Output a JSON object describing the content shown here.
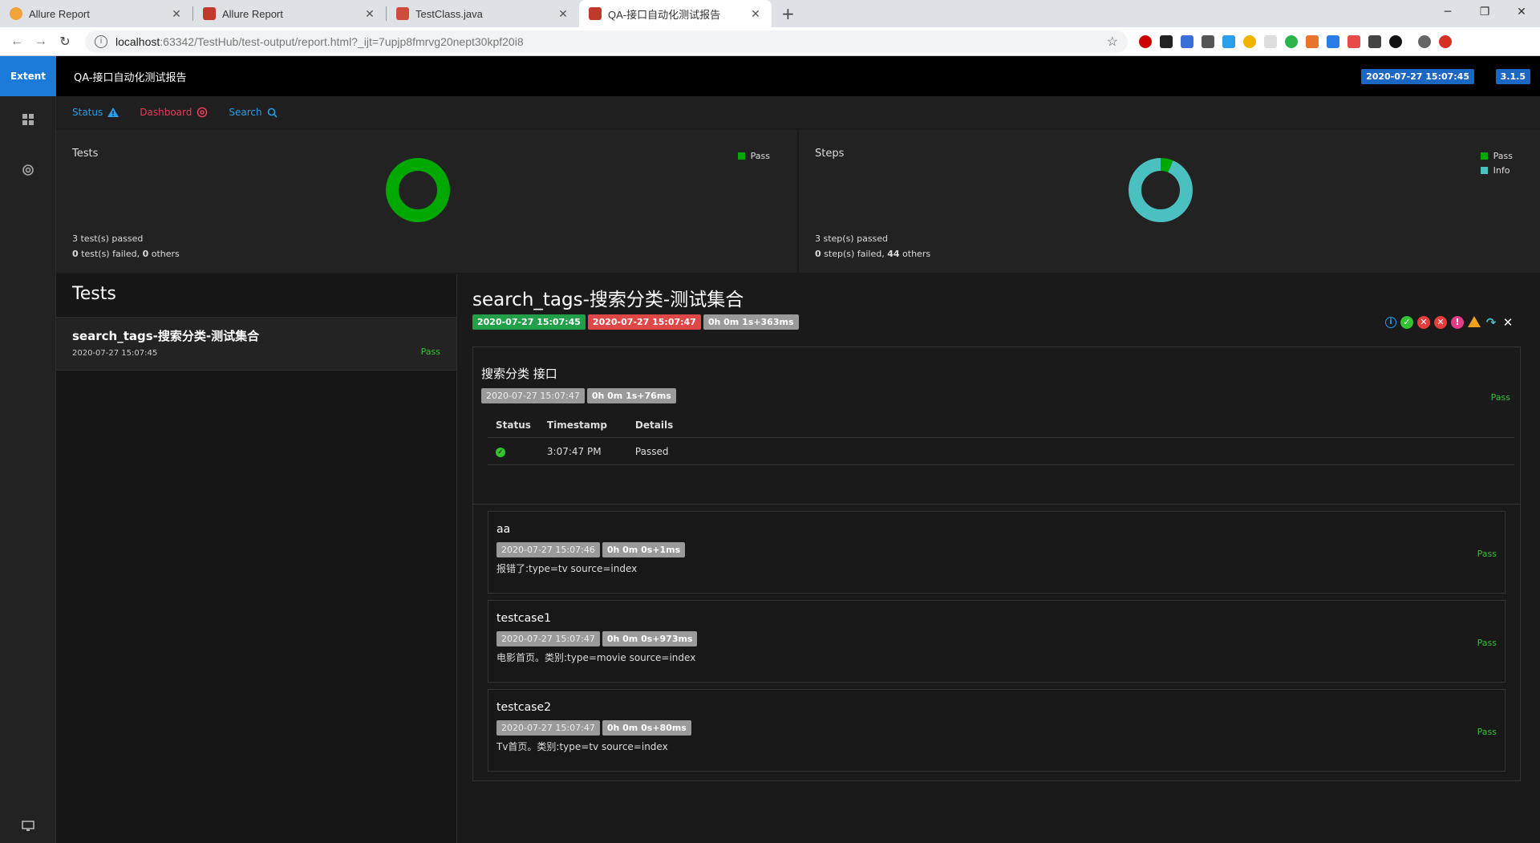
{
  "browser": {
    "tabs": [
      {
        "title": "Allure Report",
        "fav_color": "#f2a33a"
      },
      {
        "title": "Allure Report",
        "fav_color": "#c0392b"
      },
      {
        "title": "TestClass.java",
        "fav_color": "#d04c3a"
      },
      {
        "title": "QA-接口自动化测试报告",
        "fav_color": "#c0392b"
      }
    ],
    "new_tab": "+",
    "url_host": "localhost",
    "url_rest": ":63342/TestHub/test-output/report.html?_ijt=7upjp8fmrvg20nept30kpf20i8"
  },
  "app": {
    "brand": "Extent",
    "report_name": "QA-接口自动化测试报告",
    "date": "2020-07-27 15:07:45",
    "version": "3.1.5",
    "nav": {
      "status": "Status",
      "dashboard": "Dashboard",
      "search": "Search"
    }
  },
  "dashboard": {
    "tests_card": {
      "title": "Tests",
      "legend": [
        "Pass"
      ],
      "passed_line": "3 test(s) passed",
      "failed_count": "0",
      "failed_text": " test(s) failed, ",
      "others_count": "0",
      "others_text": " others",
      "chart_colors": [
        "#00a800"
      ],
      "pass_fraction": 1.0
    },
    "steps_card": {
      "title": "Steps",
      "legend": [
        "Pass",
        "Info"
      ],
      "passed_line": "3 step(s) passed",
      "failed_count": "0",
      "failed_text": " step(s) failed, ",
      "others_count": "44",
      "others_text": " others",
      "chart_colors": [
        "#00a800",
        "#4bc0c0"
      ],
      "values": [
        3,
        44
      ]
    }
  },
  "tests_panel": {
    "heading": "Tests",
    "items": [
      {
        "name": "search_tags-搜索分类-测试集合",
        "date": "2020-07-27 15:07:45",
        "status": "Pass"
      }
    ]
  },
  "detail": {
    "title": "search_tags-搜索分类-测试集合",
    "start": "2020-07-27 15:07:45",
    "end": "2020-07-27 15:07:47",
    "duration": "0h 0m 1s+363ms",
    "node": {
      "name": "搜索分类 接口",
      "time": "2020-07-27 15:07:47",
      "duration": "0h 0m 1s+76ms",
      "status": "Pass",
      "log_headers": [
        "Status",
        "Timestamp",
        "Details"
      ],
      "log_rows": [
        {
          "time": "3:07:47 PM",
          "details": "Passed"
        }
      ]
    },
    "children": [
      {
        "name": "aa",
        "time": "2020-07-27 15:07:46",
        "duration": "0h 0m 0s+1ms",
        "desc": "报错了:type=tv source=index",
        "status": "Pass"
      },
      {
        "name": "testcase1",
        "time": "2020-07-27 15:07:47",
        "duration": "0h 0m 0s+973ms",
        "desc": "电影首页。类别:type=movie source=index",
        "status": "Pass"
      },
      {
        "name": "testcase2",
        "time": "2020-07-27 15:07:47",
        "duration": "0h 0m 0s+80ms",
        "desc": "Tv首页。类别:type=tv source=index",
        "status": "Pass"
      }
    ]
  }
}
